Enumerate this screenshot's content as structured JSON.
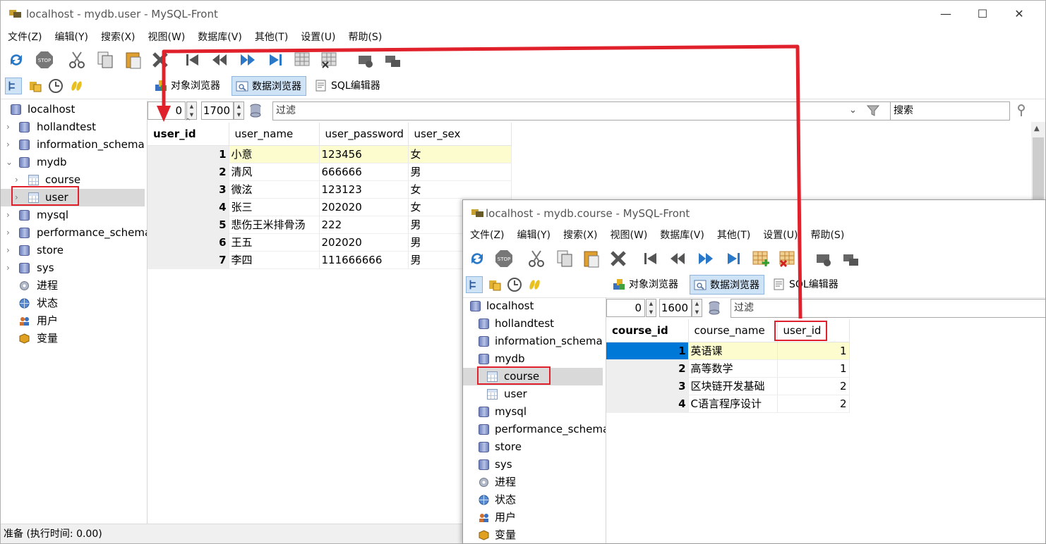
{
  "main_window": {
    "title": "localhost - mydb.user - MySQL-Front",
    "menu": [
      "文件(Z)",
      "编辑(Y)",
      "搜索(X)",
      "视图(W)",
      "数据库(V)",
      "其他(T)",
      "设置(U)",
      "帮助(S)"
    ],
    "tabs": [
      "对象浏览器",
      "数据浏览器",
      "SQL编辑器"
    ],
    "tree": {
      "root": "localhost",
      "items": [
        "hollandtest",
        "information_schema",
        "mydb",
        "course",
        "user",
        "mysql",
        "performance_schema",
        "store",
        "sys",
        "进程",
        "状态",
        "用户",
        "变量"
      ]
    },
    "offset": "0",
    "limit": "1700",
    "filter_placeholder": "过滤",
    "search_placeholder": "搜索",
    "columns": [
      "user_id",
      "user_name",
      "user_password",
      "user_sex"
    ],
    "rows": [
      [
        "1",
        "小意",
        "123456",
        "女"
      ],
      [
        "2",
        "清风",
        "666666",
        "男"
      ],
      [
        "3",
        "微泫",
        "123123",
        "女"
      ],
      [
        "4",
        "张三",
        "202020",
        "女"
      ],
      [
        "5",
        "悲伤王米排骨汤",
        "222",
        "男"
      ],
      [
        "6",
        "王五",
        "202020",
        "男"
      ],
      [
        "7",
        "李四",
        "111666666",
        "男"
      ]
    ],
    "status": "准备  (执行时间: 0.00)"
  },
  "second_window": {
    "title": "localhost - mydb.course - MySQL-Front",
    "menu": [
      "文件(Z)",
      "编辑(Y)",
      "搜索(X)",
      "视图(W)",
      "数据库(V)",
      "其他(T)",
      "设置(U)",
      "帮助(S)"
    ],
    "tabs": [
      "对象浏览器",
      "数据浏览器",
      "SQL编辑器"
    ],
    "tree": {
      "root": "localhost",
      "items": [
        "hollandtest",
        "information_schema",
        "mydb",
        "course",
        "user",
        "mysql",
        "performance_schema",
        "store",
        "sys",
        "进程",
        "状态",
        "用户",
        "变量"
      ]
    },
    "offset": "0",
    "limit": "1600",
    "filter_placeholder": "过滤",
    "columns": [
      "course_id",
      "course_name",
      "user_id"
    ],
    "rows": [
      [
        "1",
        "英语课",
        "1"
      ],
      [
        "2",
        "高等数学",
        "1"
      ],
      [
        "3",
        "区块链开发基础",
        "2"
      ],
      [
        "4",
        "C语言程序设计",
        "2"
      ]
    ]
  },
  "colors": {
    "annotation_red": "#e0202a",
    "selection_blue": "#0078d7",
    "current_row": "#fdfccf"
  }
}
